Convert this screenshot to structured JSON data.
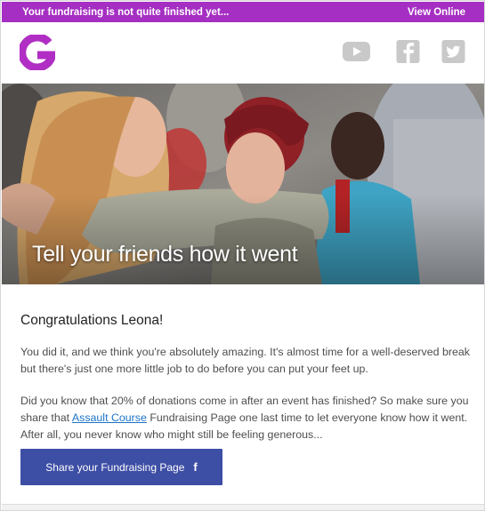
{
  "topbar": {
    "left_text": "Your fundraising is not quite finished yet...",
    "view_online": "View Online",
    "color": "#a52fc2"
  },
  "header": {
    "logo_icon": "brand-g-logo",
    "social": [
      "youtube-icon",
      "facebook-icon",
      "twitter-icon"
    ]
  },
  "hero": {
    "caption": "Tell your friends how it went"
  },
  "content": {
    "greeting": "Congratulations Leona!",
    "para1": "You did it, and we think you're absolutely amazing. It's almost time for a well-deserved break but there's just one more little job to do before you can put your feet up.",
    "para2_before": "Did you know that 20% of donations come in after an event has finished? So make sure you share that ",
    "para2_link": "Assault Course",
    "para2_after": " Fundraising Page one last time to let everyone know how it went. After all, you never know who might still be feeling generous...",
    "share_button": "Share your Fundraising Page",
    "share_icon": "f",
    "button_color": "#3d4ea5"
  }
}
